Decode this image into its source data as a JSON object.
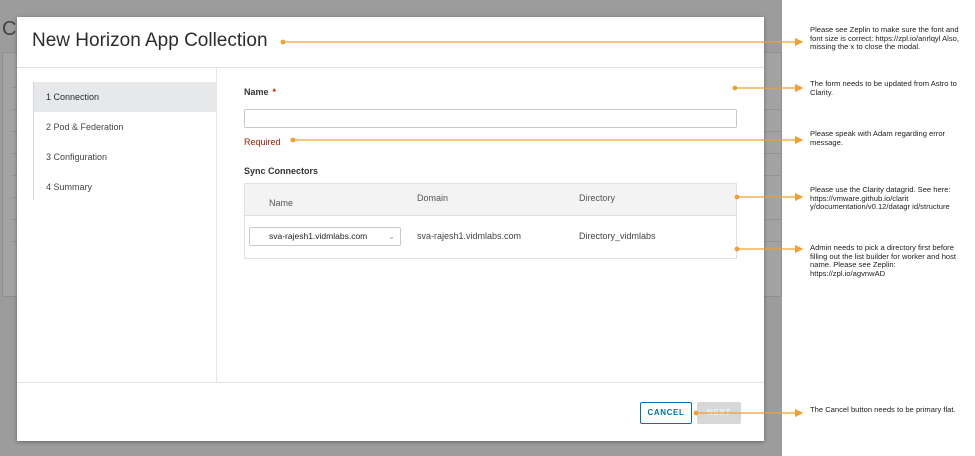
{
  "background": {
    "title_fragment": "C"
  },
  "modal": {
    "title": "New Horizon App Collection"
  },
  "wizard": {
    "steps": [
      {
        "label": "1 Connection",
        "active": true
      },
      {
        "label": "2 Pod & Federation",
        "active": false
      },
      {
        "label": "3 Configuration",
        "active": false
      },
      {
        "label": "4 Summary",
        "active": false
      }
    ]
  },
  "form": {
    "name_label": "Name",
    "required_star": "*",
    "name_value": "",
    "required_message": "Required",
    "sync_connectors_label": "Sync Connectors"
  },
  "grid": {
    "columns": [
      "Name",
      "Domain",
      "Directory"
    ],
    "rows": [
      {
        "name": "sva-rajesh1.vidmlabs.com",
        "domain": "sva-rajesh1.vidmlabs.com",
        "directory": "Directory_vidmlabs"
      }
    ]
  },
  "footer": {
    "cancel_label": "CANCEL",
    "next_label": "NEXT"
  },
  "annotations": [
    "Please see Zeplin to make sure the font and font size is correct: https://zpl.io/anrlqyl Also, missing the x to close the modal.",
    "The form needs to be updated from Astro to Clarity.",
    "Please speak with Adam regarding error message.",
    "Please use the Clarity datagrid. See here: https://vmware.github.io/clarit y/documentation/v0.12/datagr id/structure",
    "Admin needs to pick a directory first before filling out the list builder for worker and host name. Please see Zeplin: https://zpl.io/agvnwAD",
    "The Cancel button needs to be primary flat."
  ],
  "colors": {
    "annotation_line": "#f0a033",
    "primary": "#0072a3",
    "error": "#a32100"
  }
}
